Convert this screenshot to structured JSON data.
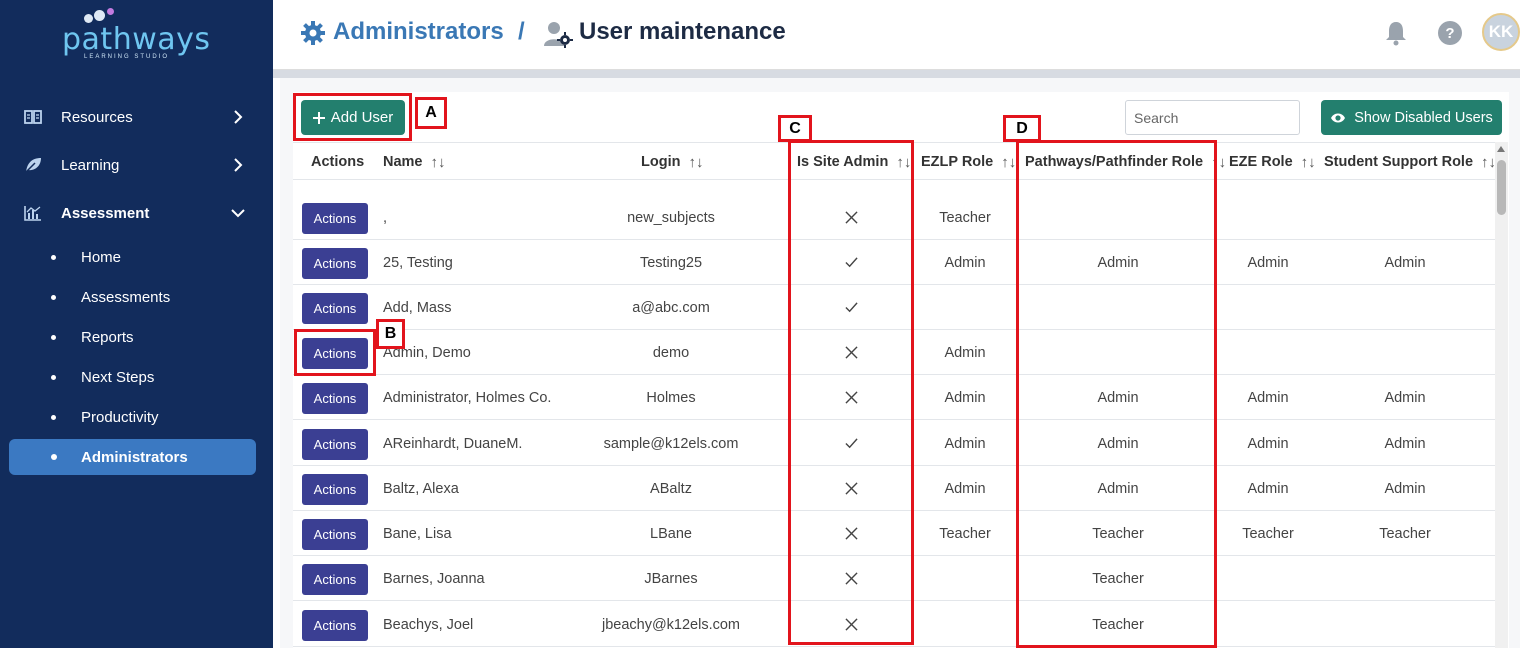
{
  "sidebar": {
    "logo": {
      "text": "pathways",
      "subtext": "LEARNING STUDIO"
    },
    "items": [
      {
        "label": "Resources",
        "icon": "book-icon"
      },
      {
        "label": "Learning",
        "icon": "leaf-icon"
      },
      {
        "label": "Assessment",
        "icon": "chart-icon"
      }
    ],
    "subitems": [
      {
        "label": "Home"
      },
      {
        "label": "Assessments"
      },
      {
        "label": "Reports"
      },
      {
        "label": "Next Steps"
      },
      {
        "label": "Productivity"
      },
      {
        "label": "Administrators",
        "active": true
      }
    ]
  },
  "header": {
    "breadcrumb_parent": "Administrators",
    "separator": "/",
    "breadcrumb_current": "User maintenance",
    "help_label": "?",
    "avatar_initials": "KK"
  },
  "toolbar": {
    "add_user_label": "Add User",
    "search_placeholder": "Search",
    "show_disabled_label": "Show Disabled Users"
  },
  "table": {
    "columns": [
      "Actions",
      "Name",
      "Login",
      "Is Site Admin",
      "EZLP Role",
      "Pathways/Pathfinder Role",
      "EZE Role",
      "Student Support Role"
    ],
    "action_label": "Actions",
    "rows": [
      {
        "name": ",",
        "login": "new_subjects",
        "site_admin": false,
        "ezlp": "Teacher",
        "pathways": "",
        "eze": "",
        "support": ""
      },
      {
        "name": "25, Testing",
        "login": "Testing25",
        "site_admin": true,
        "ezlp": "Admin",
        "pathways": "Admin",
        "eze": "Admin",
        "support": "Admin"
      },
      {
        "name": "Add, Mass",
        "login": "a@abc.com",
        "site_admin": true,
        "ezlp": "",
        "pathways": "",
        "eze": "",
        "support": ""
      },
      {
        "name": "Admin, Demo",
        "login": "demo",
        "site_admin": false,
        "ezlp": "Admin",
        "pathways": "",
        "eze": "",
        "support": ""
      },
      {
        "name": "Administrator, Holmes Co.",
        "login": "Holmes",
        "site_admin": false,
        "ezlp": "Admin",
        "pathways": "Admin",
        "eze": "Admin",
        "support": "Admin"
      },
      {
        "name": "AReinhardt, DuaneM.",
        "login": "sample@k12els.com",
        "site_admin": true,
        "ezlp": "Admin",
        "pathways": "Admin",
        "eze": "Admin",
        "support": "Admin"
      },
      {
        "name": "Baltz, Alexa",
        "login": "ABaltz",
        "site_admin": false,
        "ezlp": "Admin",
        "pathways": "Admin",
        "eze": "Admin",
        "support": "Admin"
      },
      {
        "name": "Bane, Lisa",
        "login": "LBane",
        "site_admin": false,
        "ezlp": "Teacher",
        "pathways": "Teacher",
        "eze": "Teacher",
        "support": "Teacher"
      },
      {
        "name": "Barnes, Joanna",
        "login": "JBarnes",
        "site_admin": false,
        "ezlp": "",
        "pathways": "Teacher",
        "eze": "",
        "support": ""
      },
      {
        "name": "Beachys, Joel",
        "login": "jbeachy@k12els.com",
        "site_admin": false,
        "ezlp": "",
        "pathways": "Teacher",
        "eze": "",
        "support": ""
      }
    ]
  },
  "annotations": {
    "a": "A",
    "b": "B",
    "c": "C",
    "d": "D"
  },
  "colors": {
    "sidebar_bg": "#122c5c",
    "active_item": "#3b79c2",
    "primary_button": "#237f6e",
    "actions_button": "#3b3f93",
    "annotation_red": "#e2141c",
    "breadcrumb_blue": "#3a78b5"
  }
}
